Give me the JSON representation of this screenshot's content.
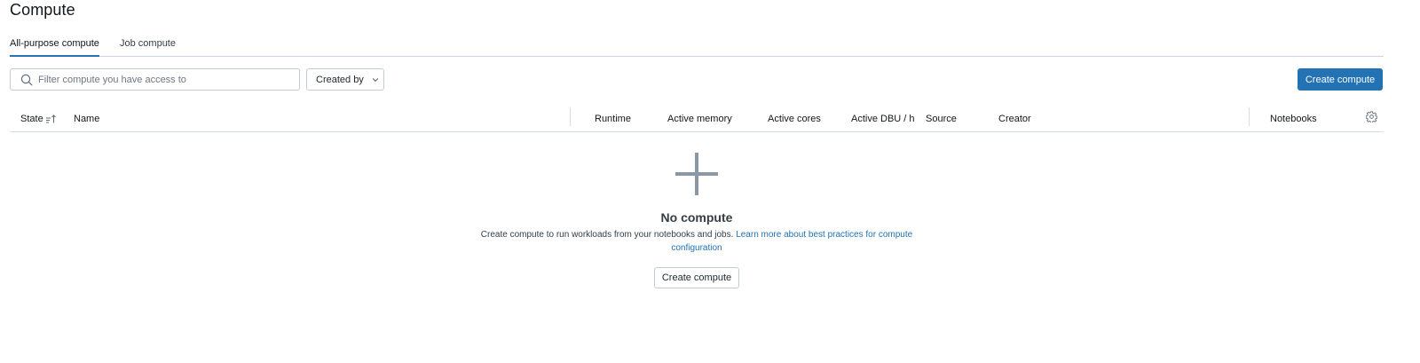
{
  "page": {
    "title": "Compute"
  },
  "tabs": [
    {
      "label": "All-purpose compute",
      "active": true
    },
    {
      "label": "Job compute",
      "active": false
    }
  ],
  "toolbar": {
    "search_placeholder": "Filter compute you have access to",
    "search_value": "",
    "created_by_label": "Created by",
    "create_button_label": "Create compute"
  },
  "table": {
    "columns": [
      "State",
      "Name",
      "Runtime",
      "Active memory",
      "Active cores",
      "Active DBU / h",
      "Source",
      "Creator",
      "Notebooks"
    ],
    "rows": []
  },
  "empty_state": {
    "title": "No compute",
    "description": "Create compute to run workloads from your notebooks and jobs.",
    "link_text": "Learn more about best practices for compute configuration",
    "button_label": "Create compute"
  },
  "colors": {
    "accent": "#2272b4",
    "icon_gray": "#8a97a5",
    "border": "#c3cbd3"
  },
  "icons": {
    "search": "search-icon",
    "dropdown": "chevron-down-icon",
    "sort": "sort-ascending-icon",
    "settings": "gear-icon",
    "empty": "plus-icon"
  }
}
